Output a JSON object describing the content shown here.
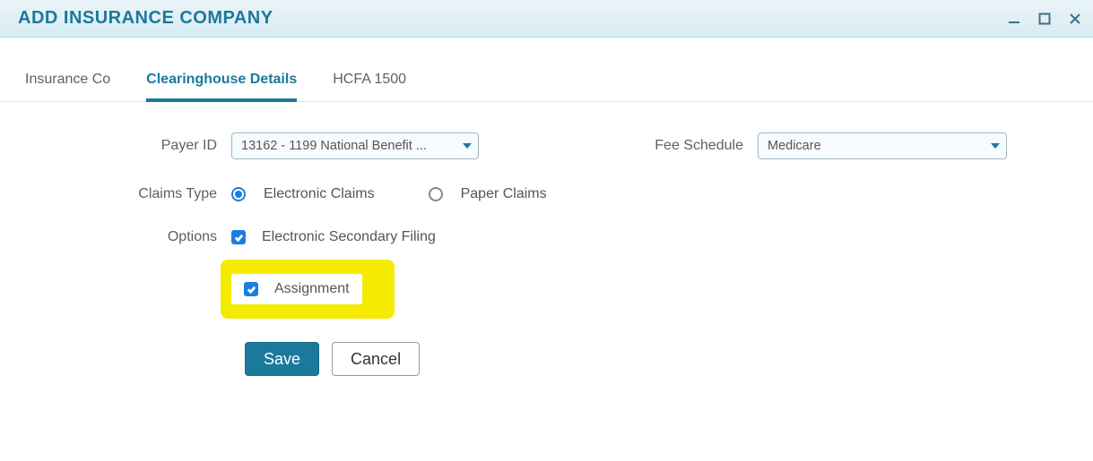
{
  "window": {
    "title": "ADD INSURANCE COMPANY"
  },
  "tabs": [
    {
      "label": "Insurance Co",
      "active": false
    },
    {
      "label": "Clearinghouse Details",
      "active": true
    },
    {
      "label": "HCFA 1500",
      "active": false
    }
  ],
  "form": {
    "payer_id": {
      "label": "Payer ID",
      "value": "13162 - 1199 National Benefit ..."
    },
    "fee_schedule": {
      "label": "Fee Schedule",
      "value": "Medicare"
    },
    "claims_type": {
      "label": "Claims Type",
      "options": [
        {
          "label": "Electronic Claims",
          "checked": true
        },
        {
          "label": "Paper Claims",
          "checked": false
        }
      ]
    },
    "options": {
      "label": "Options",
      "items": [
        {
          "label": "Electronic Secondary Filing",
          "checked": true,
          "highlight": false
        },
        {
          "label": "Assignment",
          "checked": true,
          "highlight": true
        }
      ]
    }
  },
  "buttons": {
    "save": "Save",
    "cancel": "Cancel"
  }
}
